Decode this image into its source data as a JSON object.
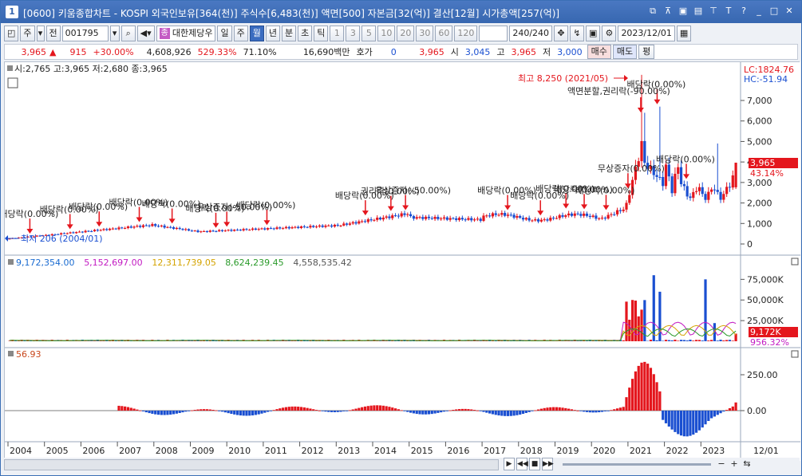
{
  "window": {
    "number": "1",
    "title": "[0600] 키움종합차트 - KOSPI 외국인보유[364(천)] 주식수[6,483(천)] 액면[500] 자본금[32(억)] 결산[12월] 시가총액[257(억)]"
  },
  "title_buttons": [
    "copy-icon",
    "pin-icon",
    "restore-small-icon",
    "T",
    "T?",
    "?",
    "minimize-icon",
    "maximize-icon",
    "close-icon"
  ],
  "toolbar": {
    "period_select": "주",
    "prev_label": "전",
    "code": "001795",
    "stock_name": "대한제당우",
    "stock_tag": "종",
    "period_day": "일",
    "period_week": "주",
    "period_month": "월",
    "period_year": "년",
    "period_min": "분",
    "period_sec": "초",
    "period_tick": "틱",
    "minute_options": [
      "1",
      "3",
      "5",
      "10",
      "20",
      "30",
      "60",
      "120"
    ],
    "count": "240",
    "count_total": "/240",
    "date": "2023/12/01"
  },
  "quote": {
    "price": "3,965",
    "change": "915",
    "change_pct": "+30.00%",
    "volume": "4,608,926",
    "vol_ratio": "529.33%",
    "turnover": "71.10%",
    "amount": "16,690백만",
    "hoga_label": "호가",
    "hoga_value": "0",
    "hoga_price": "3,965",
    "open_label": "시",
    "open_value": "3,045",
    "high_label": "고",
    "high_value": "3,965",
    "low_label": "저",
    "low_value": "3,000",
    "buy_label": "매수",
    "sell_label": "매도",
    "eval_label": "평"
  },
  "chart": {
    "ohlc_legend": "시:2,765 고:3,965 저:2,680 종:3,965",
    "lc_label": "LC:1824.76",
    "hc_label": "HC:-51.94",
    "price_axis": [
      "7,000",
      "6,000",
      "5,000",
      "4,000",
      "3,000",
      "2,000",
      "1,000",
      "0"
    ],
    "price_marker": "3,965",
    "price_marker_pct": "43.14%",
    "high_annotation": "최고 8,250 (2021/05)",
    "low_annotation": "최저 206 (2004/01)",
    "split_annotation": "액면분할,권리락(-90.00%)",
    "events": [
      {
        "label": "배당락(0.00%)",
        "year": 2004.6
      },
      {
        "label": "배당락(0.00%)",
        "year": 2005.7
      },
      {
        "label": "배당락(0.00%)",
        "year": 2006.5
      },
      {
        "label": "배당락(0.00%)",
        "year": 2007.6
      },
      {
        "label": "배당락(0.00%)",
        "year": 2008.5
      },
      {
        "label": "배당락(0.00%)",
        "year": 2009.7
      },
      {
        "label": "유상증자(-50.00%)",
        "year": 2010.0
      },
      {
        "label": "배당락(0.00%)",
        "year": 2011.1
      },
      {
        "label": "배당락(0.00%)",
        "year": 2013.8
      },
      {
        "label": "권리락(0.00%)",
        "year": 2014.5
      },
      {
        "label": "유상증자(-50.00%)",
        "year": 2014.9
      },
      {
        "label": "배당락(0.00%)",
        "year": 2017.7
      },
      {
        "label": "배당락(0.00%)",
        "year": 2018.6
      },
      {
        "label": "배당락(0.00%)",
        "year": 2019.3
      },
      {
        "label": "배당락(0.00%)",
        "year": 2019.8
      },
      {
        "label": "배당락(0.00%)",
        "year": 2020.4
      },
      {
        "label": "무상증자(0.00%)",
        "year": 2021.0
      },
      {
        "label": "배당락(0.00%)",
        "year": 2021.8
      },
      {
        "label": "배당락(0.00%)",
        "year": 2022.6
      }
    ],
    "volume_legend": [
      "9,172,354.00",
      "5,152,697.00",
      "12,311,739.05",
      "8,624,239.45",
      "4,558,535.42"
    ],
    "volume_legend_colors": [
      "#1a6bd1",
      "#c21ac2",
      "#d4a300",
      "#2a9a2a",
      "#555555"
    ],
    "volume_axis": [
      "75,000K",
      "50,000K",
      "25,000K"
    ],
    "volume_marker": "9,172K",
    "volume_marker_pct": "956.32%",
    "osc_legend": "56.93",
    "osc_axis": [
      "250.00",
      "0.00"
    ],
    "x_axis": [
      "2004",
      "2005",
      "2006",
      "2007",
      "2008",
      "2009",
      "2010",
      "2011",
      "2012",
      "2013",
      "2014",
      "2015",
      "2016",
      "2017",
      "2018",
      "2019",
      "2020",
      "2021",
      "2022",
      "2023"
    ],
    "x_end_label": "12/01"
  },
  "colors": {
    "up": "#e4161d",
    "down": "#1a4fd1",
    "accent": "#3767b0"
  }
}
